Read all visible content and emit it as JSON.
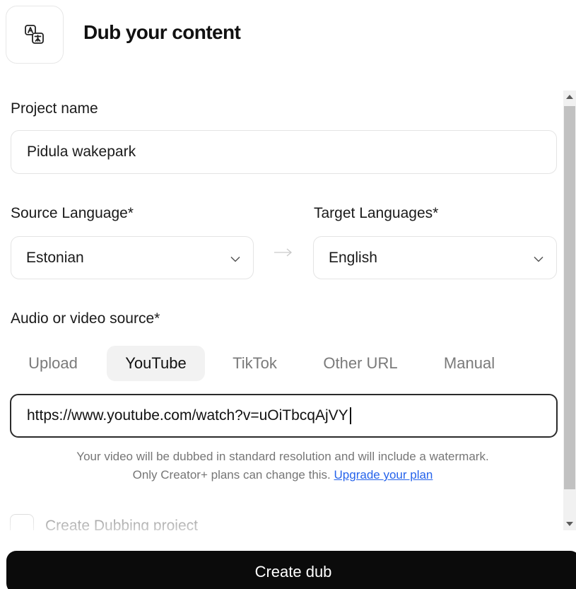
{
  "header": {
    "icon": "translate-icon",
    "title": "Dub your content"
  },
  "form": {
    "project_name_label": "Project name",
    "project_name_value": "Pidula wakepark",
    "source_language_label": "Source Language*",
    "source_language_value": "Estonian",
    "target_languages_label": "Target Languages*",
    "target_languages_value": "English",
    "source_label": "Audio or video source*",
    "tabs": [
      {
        "label": "Upload",
        "active": false
      },
      {
        "label": "YouTube",
        "active": true
      },
      {
        "label": "TikTok",
        "active": false
      },
      {
        "label": "Other URL",
        "active": false
      },
      {
        "label": "Manual",
        "active": false
      }
    ],
    "url_value": "https://www.youtube.com/watch?v=uOiTbcqAjVY",
    "note_line1": "Your video will be dubbed in standard resolution and will include a watermark.",
    "note_line2_prefix": "Only Creator+ plans can change this.",
    "upgrade_link": "Upgrade your plan",
    "checkbox_label": "Create Dubbing project"
  },
  "actions": {
    "create_label": "Create dub"
  },
  "colors": {
    "primary_button": "#0b0b0b",
    "link": "#2563eb",
    "active_tab_bg": "#f2f2f2"
  }
}
